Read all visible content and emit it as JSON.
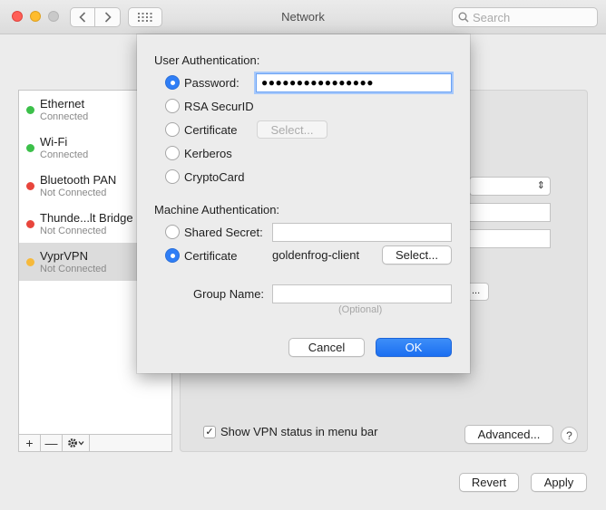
{
  "window": {
    "title": "Network",
    "search_placeholder": "Search"
  },
  "sidebar": {
    "items": [
      {
        "name": "Ethernet",
        "status": "Connected",
        "color": "#3cc04a"
      },
      {
        "name": "Wi-Fi",
        "status": "Connected",
        "color": "#3cc04a"
      },
      {
        "name": "Bluetooth PAN",
        "status": "Not Connected",
        "color": "#e8453c"
      },
      {
        "name": "Thunde...lt Bridge",
        "status": "Not Connected",
        "color": "#e8453c"
      },
      {
        "name": "VyprVPN",
        "status": "Not Connected",
        "color": "#f6b93b"
      }
    ],
    "add_label": "+",
    "remove_label": "—",
    "gear_label": "✱▾"
  },
  "sheet": {
    "user_auth_label": "User Authentication:",
    "user_options": [
      {
        "label": "Password:",
        "selected": true
      },
      {
        "label": "RSA SecurID",
        "selected": false
      },
      {
        "label": "Certificate",
        "selected": false
      },
      {
        "label": "Kerberos",
        "selected": false
      },
      {
        "label": "CryptoCard",
        "selected": false
      }
    ],
    "password_value": "●●●●●●●●●●●●●●●●",
    "cert_select_label": "Select...",
    "machine_auth_label": "Machine Authentication:",
    "machine_options": [
      {
        "label": "Shared Secret:",
        "selected": false
      },
      {
        "label": "Certificate",
        "selected": true
      }
    ],
    "shared_secret_value": "",
    "machine_cert_name": "goldenfrog-client",
    "machine_select_label": "Select...",
    "group_name_label": "Group Name:",
    "group_name_value": "",
    "group_name_hint": "(Optional)",
    "cancel_label": "Cancel",
    "ok_label": "OK"
  },
  "detail": {
    "show_vpn_status_label": "Show VPN status in menu bar",
    "show_vpn_status_checked": true,
    "advanced_label": "Advanced...",
    "help_label": "?",
    "fragment_label": "..."
  },
  "footer": {
    "revert_label": "Revert",
    "apply_label": "Apply"
  }
}
